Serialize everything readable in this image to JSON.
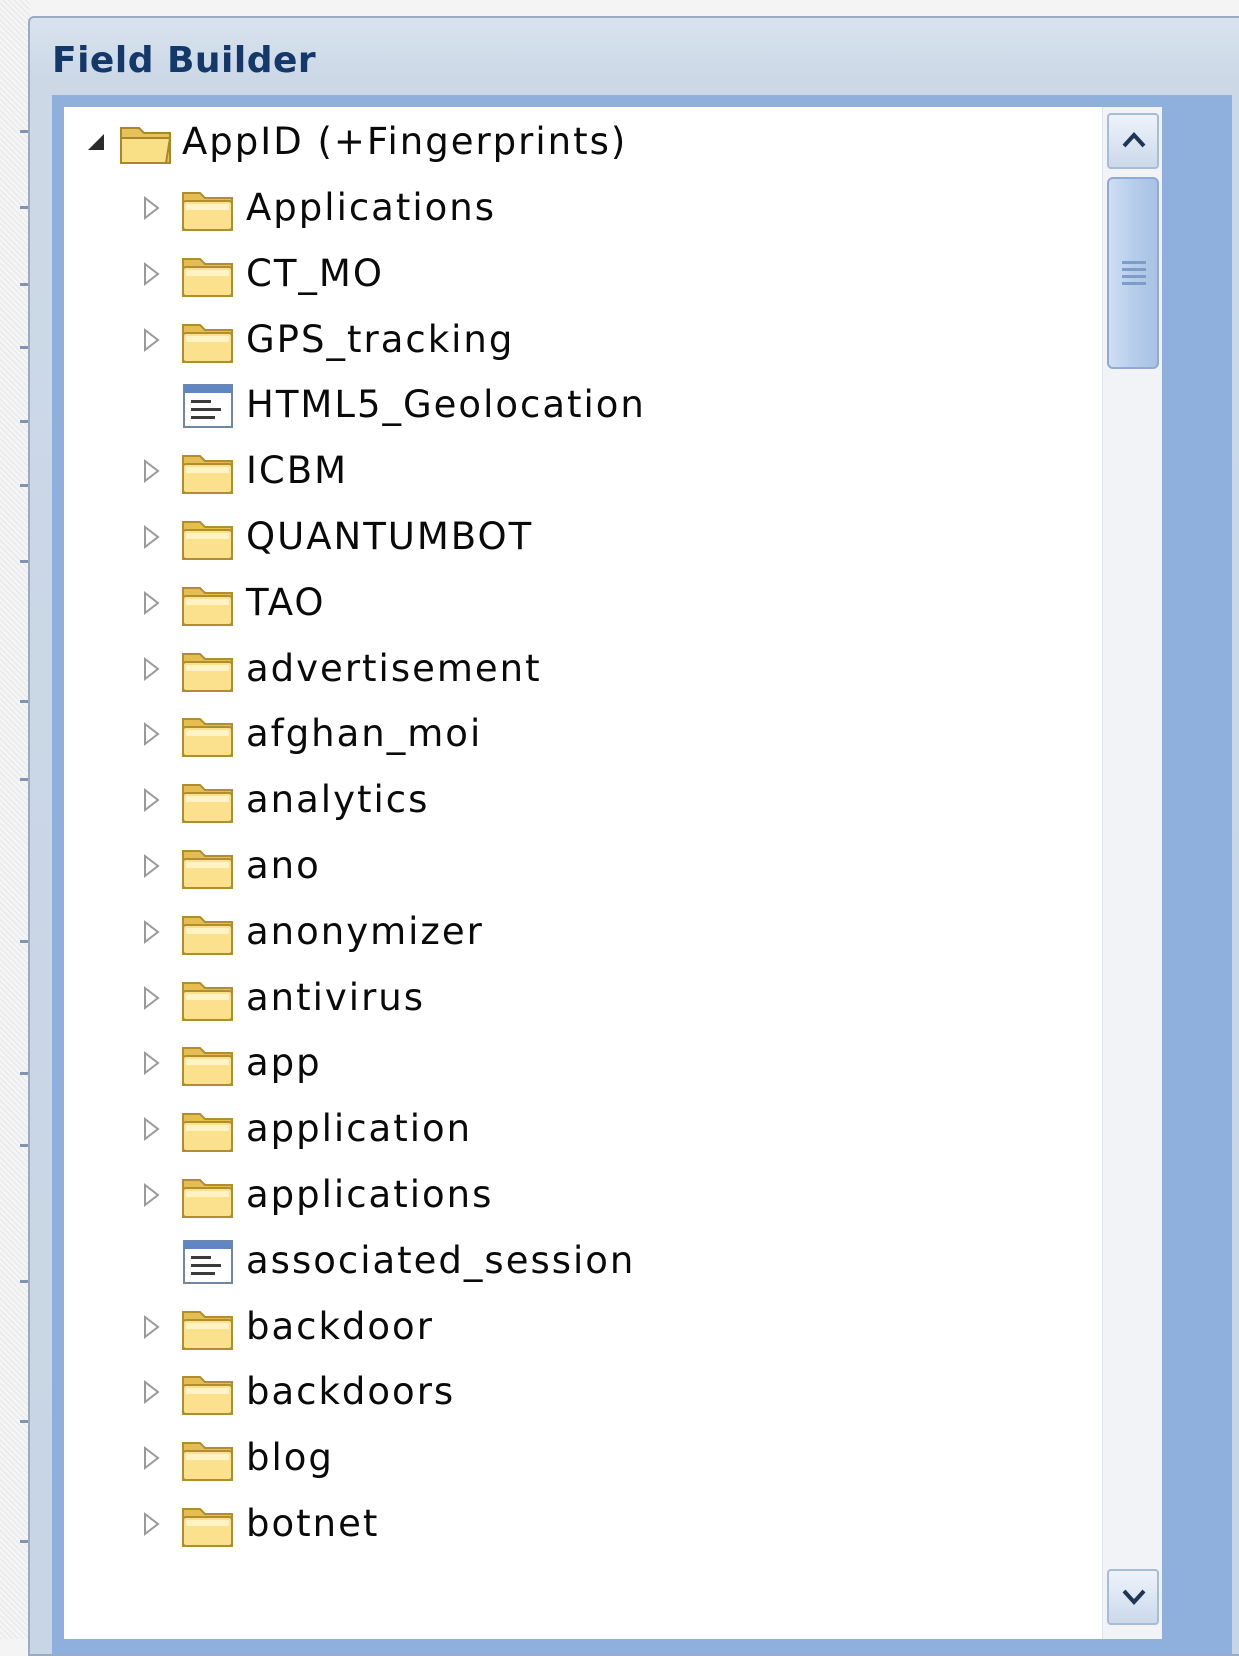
{
  "panel": {
    "title": "Field Builder"
  },
  "tree": {
    "root": {
      "label": "AppID (+Fingerprints)",
      "icon": "folder-open-icon",
      "expanded": true
    },
    "items": [
      {
        "label": "Applications",
        "type": "folder"
      },
      {
        "label": "CT_MO",
        "type": "folder"
      },
      {
        "label": "GPS_tracking",
        "type": "folder"
      },
      {
        "label": "HTML5_Geolocation",
        "type": "field"
      },
      {
        "label": "ICBM",
        "type": "folder"
      },
      {
        "label": "QUANTUMBOT",
        "type": "folder"
      },
      {
        "label": "TAO",
        "type": "folder"
      },
      {
        "label": "advertisement",
        "type": "folder"
      },
      {
        "label": "afghan_moi",
        "type": "folder"
      },
      {
        "label": "analytics",
        "type": "folder"
      },
      {
        "label": "ano",
        "type": "folder"
      },
      {
        "label": "anonymizer",
        "type": "folder"
      },
      {
        "label": "antivirus",
        "type": "folder"
      },
      {
        "label": "app",
        "type": "folder"
      },
      {
        "label": "application",
        "type": "folder"
      },
      {
        "label": "applications",
        "type": "folder"
      },
      {
        "label": "associated_session",
        "type": "field"
      },
      {
        "label": "backdoor",
        "type": "folder"
      },
      {
        "label": "backdoors",
        "type": "folder"
      },
      {
        "label": "blog",
        "type": "folder"
      },
      {
        "label": "botnet",
        "type": "folder"
      }
    ]
  },
  "scrollbar": {
    "up_icon": "chevron-up-icon",
    "down_icon": "chevron-down-icon",
    "grip_icon": "grip-lines-icon"
  },
  "colors": {
    "panel_title": "#15386b",
    "tree_border": "#8fb0dc",
    "folder_fill": "#f7d774",
    "folder_edge": "#b8962e"
  }
}
